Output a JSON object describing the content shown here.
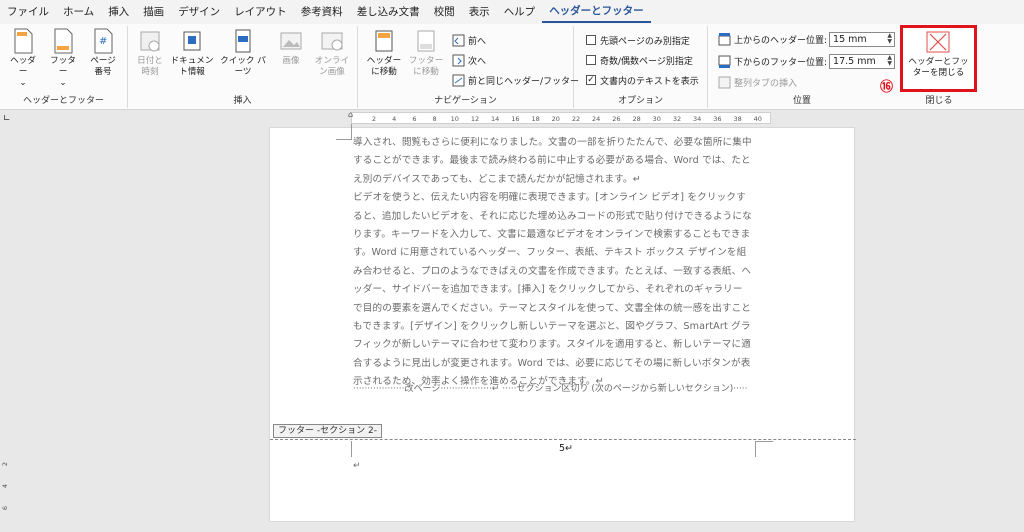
{
  "menubar": {
    "tabs": [
      "ファイル",
      "ホーム",
      "挿入",
      "描画",
      "デザイン",
      "レイアウト",
      "参考資料",
      "差し込み文書",
      "校閲",
      "表示",
      "ヘルプ",
      "ヘッダーとフッター"
    ],
    "active": "ヘッダーとフッター"
  },
  "ribbon": {
    "groups": {
      "header_footer": "ヘッダーとフッター",
      "insert": "挿入",
      "navigation": "ナビゲーション",
      "options": "オプション",
      "position": "位置",
      "close": "閉じる"
    },
    "header_btn": "ヘッダー",
    "footer_btn": "フッター",
    "page_number_btn": "ページ番号",
    "date_time_btn": "日付と時刻",
    "doc_info_btn": "ドキュメント情報",
    "quick_parts_btn": "クイック パーツ",
    "picture_btn": "画像",
    "online_picture_btn": "オンライン画像",
    "goto_header_btn": "ヘッダーに移動",
    "goto_footer_btn": "フッターに移動",
    "prev_btn": "前へ",
    "next_btn": "次へ",
    "link_prev_btn": "前と同じヘッダー/フッター",
    "opt_first_page": "先頭ページのみ別指定",
    "opt_odd_even": "奇数/偶数ページ別指定",
    "opt_show_text": "文書内のテキストを表示",
    "header_top_label": "上からのヘッダー位置:",
    "header_top_value": "15 mm",
    "footer_bottom_label": "下からのフッター位置:",
    "footer_bottom_value": "17.5 mm",
    "align_tab_btn": "整列タブの挿入",
    "close_btn": "ヘッダーとフッターを閉じる",
    "callout_number": "⑯"
  },
  "ruler": {
    "ticks": [
      "2",
      "4",
      "6",
      "8",
      "10",
      "12",
      "14",
      "16",
      "18",
      "20",
      "22",
      "24",
      "26",
      "28",
      "30",
      "32",
      "34",
      "36",
      "38",
      "40"
    ],
    "vticks": [
      "2",
      "4",
      "6"
    ]
  },
  "document": {
    "body": "導入され、閲覧もさらに便利になりました。文書の一部を折りたたんで、必要な箇所に集中\nすることができます。最後まで読み終わる前に中止する必要がある場合、Word では、たと\nえ別のデバイスであっても、どこまで読んだかが記憶されます。↵\nビデオを使うと、伝えたい内容を明確に表現できます。[オンライン ビデオ] をクリックす\nると、追加したいビデオを、それに応じた埋め込みコードの形式で貼り付けできるようにな\nります。キーワードを入力して、文書に最適なビデオをオンラインで検索することもできま\nす。Word に用意されているヘッダー、フッター、表紙、テキスト ボックス デザインを組\nみ合わせると、プロのようなできばえの文書を作成できます。たとえば、一致する表紙、ヘ\nッダー、サイドバーを追加できます。[挿入] をクリックしてから、それぞれのギャラリー\nで目的の要素を選んでください。テーマとスタイルを使って、文書全体の統一感を出すこと\nもできます。[デザイン] をクリックし新しいテーマを選ぶと、図やグラフ、SmartArt グラ\nフィックが新しいテーマに合わせて変わります。スタイルを適用すると、新しいテーマに適\n合するように見出しが変更されます。Word では、必要に応じてその場に新しいボタンが表\n示されるため、効率よく操作を進めることができます。↵",
    "page_break": "··················改ページ··················↵ ·····セクション区切り (次のページから新しいセクション)·····",
    "footer_tab": "フッター -セクション 2-",
    "page_number": "5↵",
    "footer_para": "↵"
  },
  "colors": {
    "accent": "#2b579a",
    "callout": "#e0121c"
  }
}
